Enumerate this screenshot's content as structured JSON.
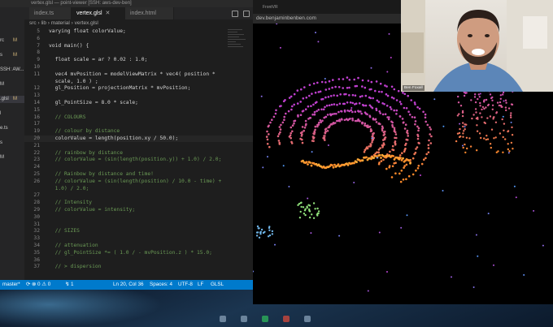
{
  "vscode": {
    "window_title": "vertex.glsl — point-viewer [SSH: aws-dev-ben]",
    "tabs": [
      {
        "label": "index.ts",
        "active": false
      },
      {
        "label": "vertex.glsl",
        "active": true
      },
      {
        "label": "index.html",
        "active": false
      }
    ],
    "breadcrumb": "src › lib › material › vertex.glsl",
    "sidebar_items": [
      {
        "label": "rc",
        "marker": "M"
      },
      {
        "label": "s",
        "marker": "M"
      },
      {
        "label": "SSH: AW...",
        "marker": ""
      },
      {
        "label": "M",
        "marker": ""
      },
      {
        "label": ".glsl",
        "marker": "M"
      },
      {
        "label": "l",
        "marker": ""
      },
      {
        "label": "e.ts",
        "marker": ""
      },
      {
        "label": "s",
        "marker": ""
      },
      {
        "label": "M",
        "marker": ""
      }
    ],
    "code_lines": [
      {
        "n": "5",
        "text": "varying float colorValue;",
        "type": "code"
      },
      {
        "n": "6",
        "text": "",
        "type": "code"
      },
      {
        "n": "7",
        "text": "void main() {",
        "type": "code"
      },
      {
        "n": "8",
        "text": "",
        "type": "code"
      },
      {
        "n": "9",
        "text": "  float scale = ar ? 0.02 : 1.0;",
        "type": "code"
      },
      {
        "n": "10",
        "text": "",
        "type": "code"
      },
      {
        "n": "11",
        "text": "  vec4 mvPosition = modelViewMatrix * vec4( position *",
        "type": "code"
      },
      {
        "n": "",
        "text": "  scale, 1.0 ) ;",
        "type": "code"
      },
      {
        "n": "12",
        "text": "  gl_Position = projectionMatrix * mvPosition;",
        "type": "code"
      },
      {
        "n": "13",
        "text": "",
        "type": "code"
      },
      {
        "n": "14",
        "text": "  gl_PointSize = 8.0 * scale;",
        "type": "code"
      },
      {
        "n": "15",
        "text": "",
        "type": "code"
      },
      {
        "n": "16",
        "text": "  // COLOURS",
        "type": "comment"
      },
      {
        "n": "17",
        "text": "",
        "type": "code"
      },
      {
        "n": "19",
        "text": "  // colour by distance",
        "type": "comment"
      },
      {
        "n": "20",
        "text": "  colorValue = length(position.xy / 50.0);",
        "type": "cur"
      },
      {
        "n": "21",
        "text": "",
        "type": "code"
      },
      {
        "n": "22",
        "text": "  // rainbow by distance",
        "type": "comment"
      },
      {
        "n": "23",
        "text": "  // colorValue = (sin(length(position.y)) + 1.0) / 2.0;",
        "type": "comment"
      },
      {
        "n": "24",
        "text": "",
        "type": "code"
      },
      {
        "n": "25",
        "text": "  // Rainbow by distance and time!",
        "type": "comment"
      },
      {
        "n": "26",
        "text": "  // colorValue = (sin(length(position) / 10.0 - time) +",
        "type": "comment"
      },
      {
        "n": "",
        "text": "  1.0) / 2.0;",
        "type": "comment"
      },
      {
        "n": "27",
        "text": "",
        "type": "code"
      },
      {
        "n": "28",
        "text": "  // Intensity",
        "type": "comment"
      },
      {
        "n": "29",
        "text": "  // colorValue = intensity;",
        "type": "comment"
      },
      {
        "n": "30",
        "text": "",
        "type": "code"
      },
      {
        "n": "31",
        "text": "",
        "type": "code"
      },
      {
        "n": "32",
        "text": "  // SIZES",
        "type": "comment"
      },
      {
        "n": "33",
        "text": "",
        "type": "code"
      },
      {
        "n": "34",
        "text": "  // attenuation",
        "type": "comment"
      },
      {
        "n": "35",
        "text": "  // gl_PointSize *= ( 1.0 / - mvPosition.z ) * 15.0;",
        "type": "comment"
      },
      {
        "n": "36",
        "text": "",
        "type": "code"
      },
      {
        "n": "37",
        "text": "  // > dispersion",
        "type": "comment"
      }
    ],
    "status_bar": {
      "branch": "master*",
      "sync": "⟳ ⊗ 0 ⚠ 0",
      "remote": "↯ 1",
      "position": "Ln 20, Col 36",
      "spaces": "Spaces: 4",
      "encoding": "UTF-8",
      "eol": "LF",
      "language": "GLSL"
    }
  },
  "browser": {
    "url": "dev.benjaminbenben.com",
    "tab_label": "FrontVR"
  },
  "webcam": {
    "name": "Ben Foxall"
  },
  "colors": {
    "vscode_bg": "#1e1e1e",
    "status_blue": "#007acc",
    "comment_green": "#6a9955",
    "point_magenta": "#c040d0",
    "point_orange": "#ff8a2a"
  }
}
